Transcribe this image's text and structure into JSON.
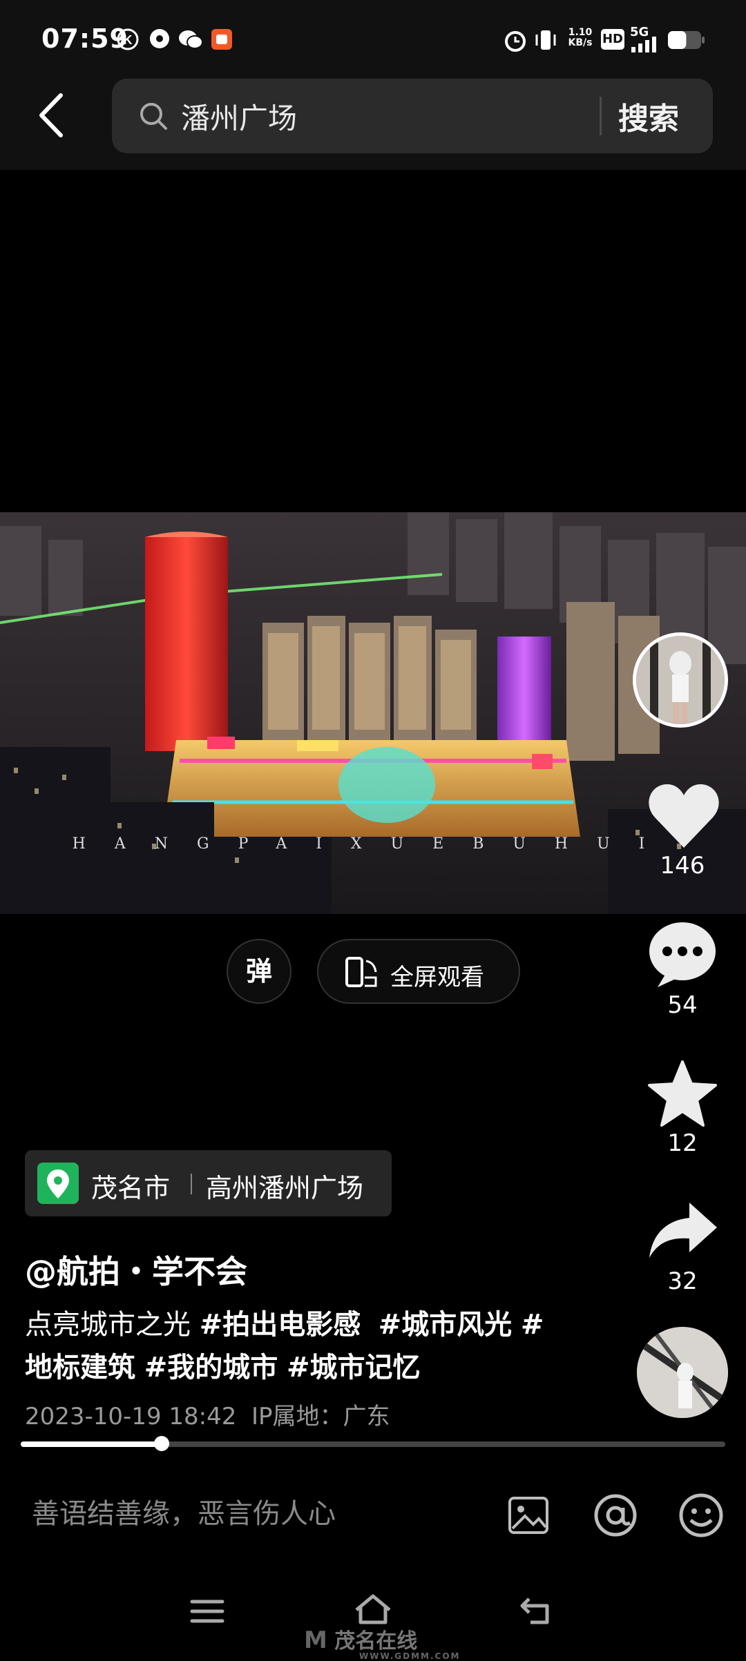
{
  "status_bar": {
    "time": "07:59",
    "net_speed_value": "1.10",
    "net_speed_unit": "KB/s",
    "hd_badge": "HD",
    "network": "5G",
    "battery_level": 0.55,
    "icons": [
      "k-app-icon",
      "location-bubble-icon",
      "wechat-icon",
      "app-badge-icon",
      "alarm-icon",
      "vibrate-icon",
      "signal-icon",
      "battery-icon"
    ]
  },
  "header": {
    "query": "潘州广场",
    "search_button": "搜索"
  },
  "video": {
    "watermark": "HANGPAIXUEBUHUI"
  },
  "actions": {
    "likes": "146",
    "comments": "54",
    "favorites": "12",
    "shares": "32"
  },
  "controls": {
    "danmu": "弹",
    "fullscreen": "全屏观看"
  },
  "location": {
    "city": "茂名市",
    "place": "高州潘州广场"
  },
  "post": {
    "author": "@航拍・学不会",
    "desc_plain": "点亮城市之光 ",
    "tags": [
      "#拍出电影感",
      "#城市风光",
      "#地标建筑",
      "#我的城市",
      "#城市记忆"
    ],
    "date": "2023-10-19 18:42",
    "ip": "IP属地：广东"
  },
  "playback": {
    "progress": 0.2
  },
  "comment_bar": {
    "placeholder": "善语结善缘，恶言伤人心"
  },
  "nav": {
    "brand": "茂名在线",
    "brand_sub": "WWW.GDMM.COM"
  },
  "colors": {
    "location_pin": "#1fb45b",
    "background": "#000000"
  }
}
